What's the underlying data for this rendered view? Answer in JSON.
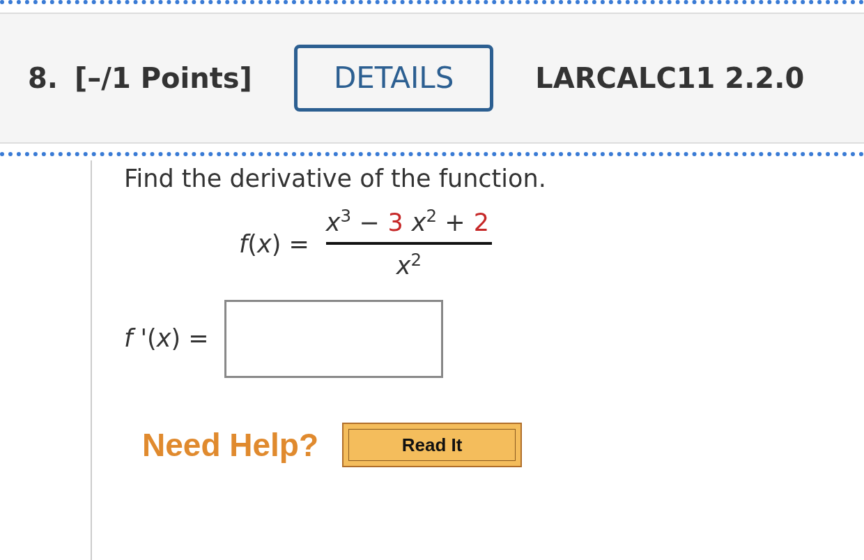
{
  "question": {
    "number": "8.",
    "points": "[–/1 Points]",
    "details_button": "DETAILS",
    "source": "LARCALC11 2.2.0"
  },
  "prompt": "Find the derivative of the function.",
  "formula": {
    "lhs": "*f*(*x*) =",
    "numerator_terms": [
      {
        "text": "*x*$^{3}$ −",
        "color": "#333333"
      },
      {
        "text": "3",
        "color": "#c62828"
      },
      {
        "text": "*x*$^{2}$ +",
        "color": "#333333"
      },
      {
        "text": "2",
        "color": "#c62828"
      }
    ],
    "denominator": "*x*$^{2}$"
  },
  "answer": {
    "label": "*f* '(*x*) ="
  },
  "help": {
    "label": "Need Help?",
    "buttons": [
      "Read It"
    ]
  }
}
